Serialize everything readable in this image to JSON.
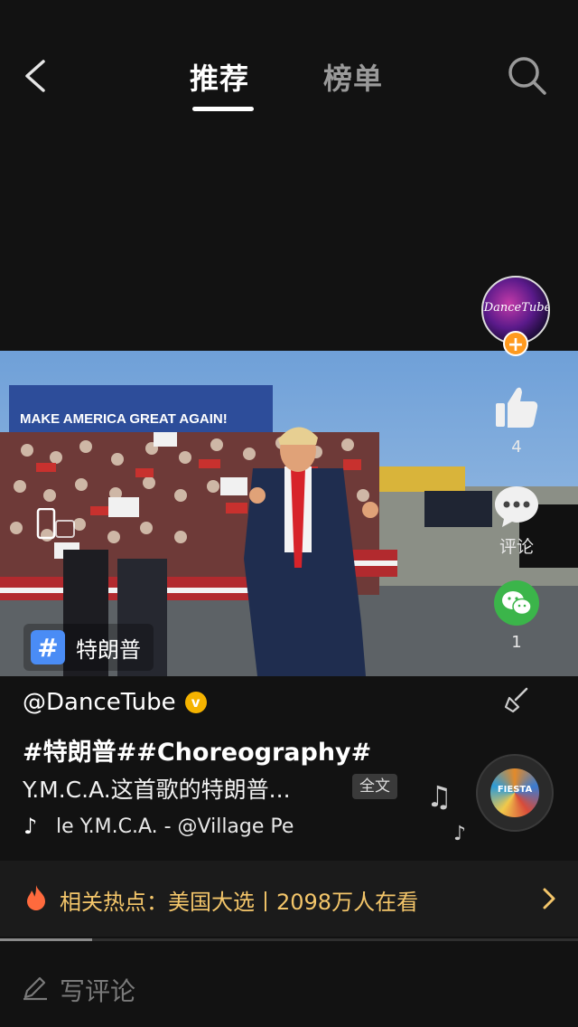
{
  "nav": {
    "tabs": [
      {
        "label": "推荐",
        "active": true
      },
      {
        "label": "榜单",
        "active": false
      }
    ]
  },
  "video": {
    "topic_tag": "特朗普",
    "banner_text": "MAKE AMERICA GREAT AGAIN!"
  },
  "author": {
    "avatar_text": "DanceTube",
    "handle": "@DanceTube",
    "verified": true
  },
  "actions": {
    "like_count": "4",
    "comment_label": "评论",
    "share_count": "1"
  },
  "post": {
    "hashtags": "#特朗普##Choreography#",
    "description": "Y.M.C.A.这首歌的特朗普...",
    "fulltext_label": "全文",
    "music": "le    Y.M.C.A. - @Village Pe",
    "disc_label": "FIESTA"
  },
  "hot_topic": {
    "text": "相关热点：美国大选丨2098万人在看"
  },
  "playback": {
    "progress_fraction": 0.16
  },
  "comment_input": {
    "placeholder": "写评论"
  },
  "colors": {
    "background": "#121212",
    "hot_text": "#f4c66a",
    "follow": "#ff9a1f",
    "wechat": "#3bb54a",
    "tag": "#4a8cf5"
  },
  "icons": [
    "back-arrow-icon",
    "search-icon",
    "orientation-icon",
    "hashtag-icon",
    "plus-icon",
    "thumbs-up-icon",
    "comment-icon",
    "wechat-icon",
    "verified-icon",
    "broom-icon",
    "music-note-icon",
    "flame-icon",
    "chevron-right-icon",
    "pen-icon"
  ]
}
